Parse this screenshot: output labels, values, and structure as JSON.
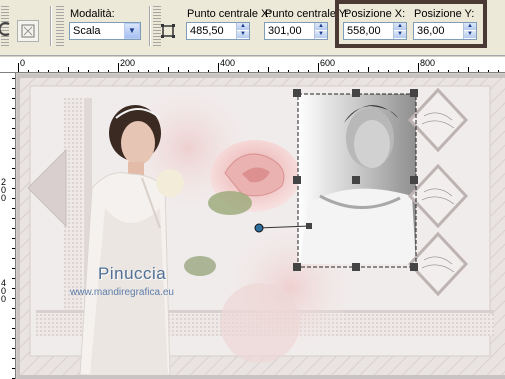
{
  "toolbar": {
    "mode": {
      "label": "Modalità:",
      "value": "Scala"
    },
    "center_x": {
      "label": "Punto centrale X:",
      "value": "485,50"
    },
    "center_y": {
      "label": "Punto centrale Y:",
      "value": "301,00"
    },
    "pos_x": {
      "label": "Posizione X:",
      "value": "558,00"
    },
    "pos_y": {
      "label": "Posizione Y:",
      "value": "36,00"
    }
  },
  "ruler": {
    "horizontal": [
      "0",
      "200",
      "400",
      "600",
      "800"
    ],
    "vertical": [
      "2",
      "0",
      "0",
      "4",
      "0",
      "0"
    ]
  },
  "canvas": {
    "watermark_name": "Pinuccia",
    "watermark_url": "www.mandiregrafica.eu"
  },
  "colors": {
    "highlight_border": "#4a3a33",
    "rose": "#f0c5c5",
    "canvas_bg": "#ece6e5"
  }
}
